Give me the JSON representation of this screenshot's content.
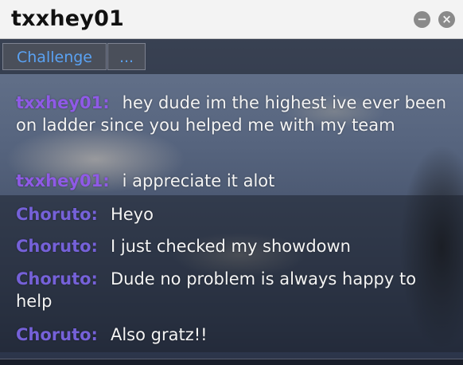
{
  "window": {
    "title": "txxhey01",
    "minimize_icon": "minimize-icon",
    "close_icon": "close-icon"
  },
  "tabs": [
    {
      "label": "Challenge"
    },
    {
      "label": "..."
    }
  ],
  "messages": [
    {
      "user": "txxhey01:",
      "text": "hey dude im the highest ive ever been on ladder since you helped me with my team"
    },
    {
      "user": "txxhey01:",
      "text": "i appreciate it alot"
    },
    {
      "user": "Choruto:",
      "text": "Heyo"
    },
    {
      "user": "Choruto:",
      "text": "I just checked my showdown"
    },
    {
      "user": "Choruto:",
      "text": "Dude no problem is always happy to help"
    },
    {
      "user": "Choruto:",
      "text": "Also gratz!!"
    }
  ],
  "colors": {
    "user_txxhey01": "#8f5ae6",
    "user_choruto": "#7561d8",
    "tab_text": "#5aa2f3"
  }
}
